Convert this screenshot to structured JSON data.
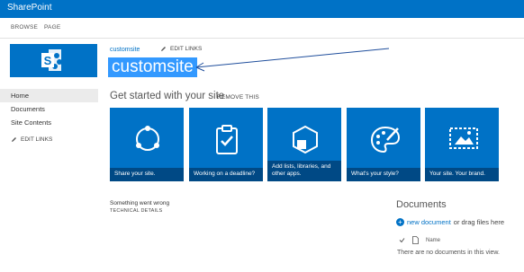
{
  "suite_bar": {
    "brand": "SharePoint",
    "color": "#0072c6"
  },
  "ribbon": {
    "tabs": [
      "BROWSE",
      "PAGE"
    ]
  },
  "logo": {
    "icon": "sharepoint-logo-icon"
  },
  "quick_launch": {
    "items": [
      {
        "label": "Home",
        "selected": true
      },
      {
        "label": "Documents"
      },
      {
        "label": "Site Contents"
      }
    ],
    "edit_links": "EDIT LINKS"
  },
  "header": {
    "breadcrumb": "customsite",
    "edit_links": "EDIT LINKS",
    "site_title": "customsite"
  },
  "get_started": {
    "heading": "Get started with your site",
    "remove": "REMOVE THIS",
    "tiles": [
      {
        "caption": "Share your site.",
        "icon": "share-icon"
      },
      {
        "caption": "Working on a deadline?",
        "icon": "clipboard-check-icon"
      },
      {
        "caption": "Add lists, libraries, and other apps.",
        "icon": "hexagon-icon"
      },
      {
        "caption": "What's your style?",
        "icon": "palette-icon"
      },
      {
        "caption": "Your site. Your brand.",
        "icon": "picture-icon"
      }
    ]
  },
  "error": {
    "message": "Something went wrong",
    "details": "TECHNICAL DETAILS"
  },
  "documents": {
    "title": "Documents",
    "new_document": "new document",
    "drag_text": " or drag files here",
    "column_name": "Name",
    "empty_text": "There are no documents in this view."
  }
}
